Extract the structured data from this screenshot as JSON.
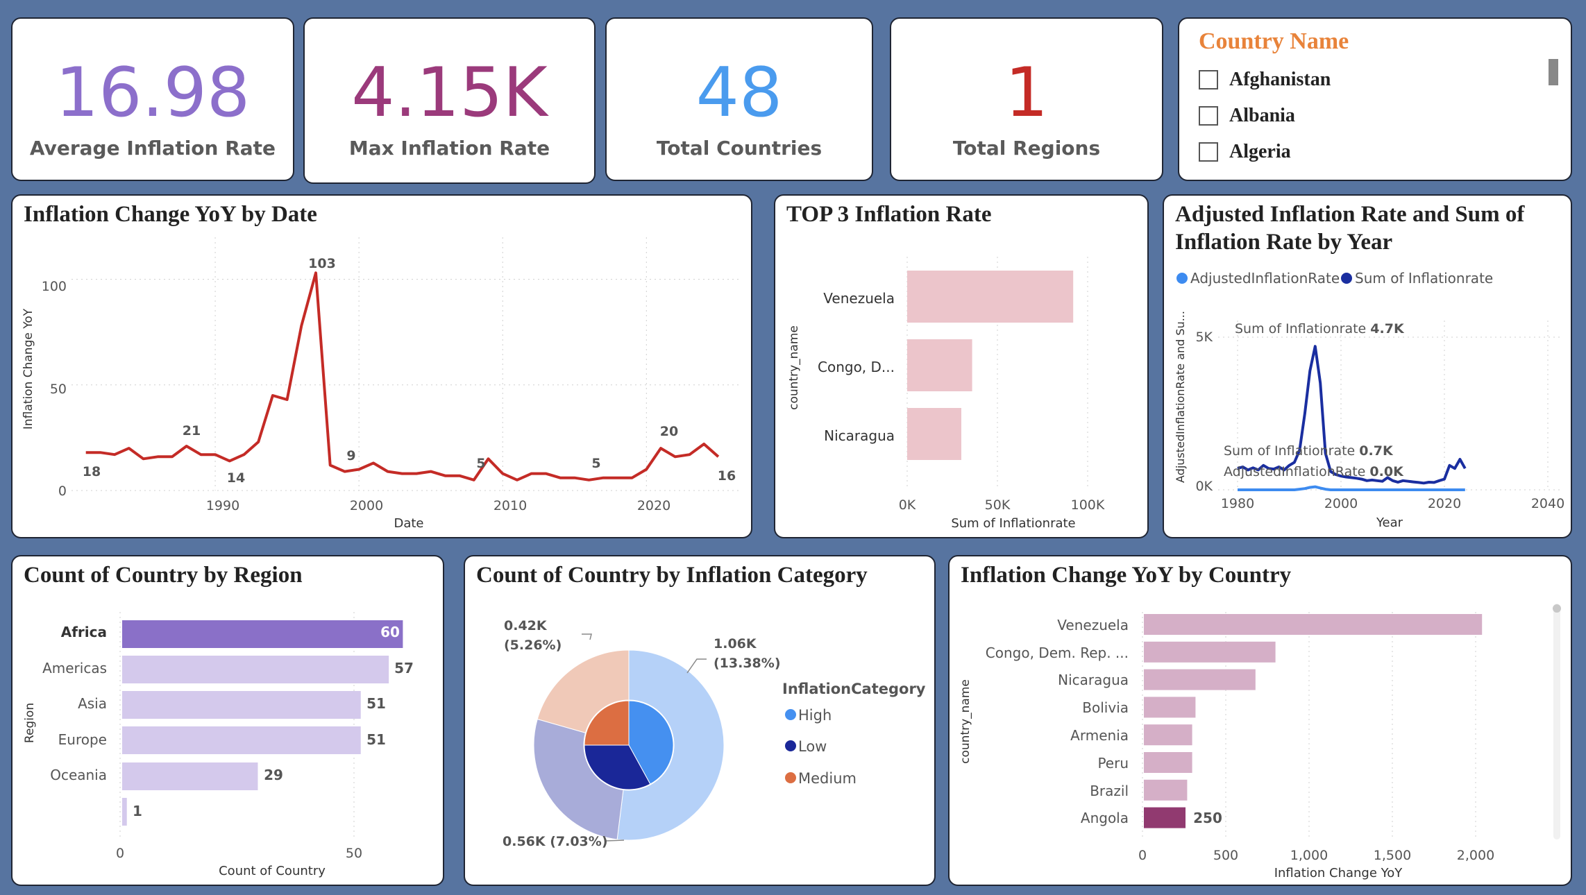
{
  "kpis": [
    {
      "value": "16.98",
      "label": "Average Inflation Rate",
      "color": "#8c6fcb"
    },
    {
      "value": "4.15K",
      "label": "Max Inflation Rate",
      "color": "#9b3a7b"
    },
    {
      "value": "48",
      "label": "Total Countries",
      "color": "#4a9bee"
    },
    {
      "value": "1",
      "label": "Total Regions",
      "color": "#c42b26"
    }
  ],
  "slicer": {
    "title": "Country Name",
    "items": [
      "Afghanistan",
      "Albania",
      "Algeria"
    ]
  },
  "charts": {
    "yoy_date": {
      "title": "Inflation Change YoY by Date",
      "xlabel": "Date",
      "ylabel": "Inflation Change YoY",
      "xticks": [
        "1990",
        "2000",
        "2010",
        "2020"
      ],
      "yticks": [
        "0",
        "50",
        "100"
      ],
      "labels": [
        "18",
        "21",
        "14",
        "103",
        "9",
        "5",
        "5",
        "20",
        "16"
      ]
    },
    "top3": {
      "title": "TOP 3 Inflation Rate",
      "xlabel": "Sum of Inflationrate",
      "ylabel": "country_name",
      "xticks": [
        "0K",
        "50K",
        "100K"
      ],
      "categories": [
        "Venezuela",
        "Congo, D...",
        "Nicaragua"
      ]
    },
    "adjusted": {
      "title_line1": "Adjusted Inflation Rate and Sum of",
      "title_line2": "Inflation Rate by Year",
      "xlabel": "Year",
      "ylabel": "AdjustedInflationRate and Su...",
      "xticks": [
        "1980",
        "2000",
        "2020",
        "2040"
      ],
      "yticks": [
        "0K",
        "5K"
      ],
      "legend": [
        "AdjustedInflationRate",
        "Sum of Inflationrate"
      ],
      "ann1_label": "Sum of Inflationrate",
      "ann1_value": "4.7K",
      "ann2_label": "Sum of Inflationrate",
      "ann2_value": "0.7K",
      "ann3_label": "AdjustedInflationRate",
      "ann3_value": "0.0K"
    },
    "region": {
      "title": "Count of Country by Region",
      "xlabel": "Count of Country",
      "ylabel": "Region",
      "xticks": [
        "0",
        "50"
      ],
      "categories": [
        "Africa",
        "Americas",
        "Asia",
        "Europe",
        "Oceania",
        ""
      ],
      "value_labels": [
        "60",
        "57",
        "51",
        "51",
        "29",
        "1"
      ]
    },
    "category": {
      "title": "Count of Country by Inflation Category",
      "legend_title": "InflationCategory",
      "legend": [
        "High",
        "Low",
        "Medium"
      ],
      "lbl_a": "1.06K",
      "lbl_a2": "(13.38%)",
      "lbl_b": "0.42K",
      "lbl_b2": "(5.26%)",
      "lbl_c": "0.56K (7.03%)"
    },
    "yoy_country": {
      "title": "Inflation Change YoY by Country",
      "xlabel": "Inflation Change YoY",
      "ylabel": "country_name",
      "xticks": [
        "0",
        "500",
        "1,000",
        "1,500",
        "2,000"
      ],
      "categories": [
        "Venezuela",
        "Congo, Dem. Rep. ...",
        "Nicaragua",
        "Bolivia",
        "Armenia",
        "Peru",
        "Brazil",
        "Angola"
      ],
      "value_label": "250"
    }
  },
  "chart_data": [
    {
      "type": "line",
      "title": "Inflation Change YoY by Date",
      "xlabel": "Date",
      "ylabel": "Inflation Change YoY",
      "ylim": [
        0,
        110
      ],
      "x": [
        1981,
        1982,
        1983,
        1984,
        1985,
        1986,
        1987,
        1988,
        1989,
        1990,
        1991,
        1992,
        1993,
        1994,
        1995,
        1996,
        1997,
        1998,
        1999,
        2000,
        2001,
        2002,
        2003,
        2004,
        2005,
        2006,
        2007,
        2008,
        2009,
        2010,
        2011,
        2012,
        2013,
        2014,
        2015,
        2016,
        2017,
        2018,
        2019,
        2020,
        2021,
        2022,
        2023,
        2024,
        2025
      ],
      "values": [
        18,
        18,
        17,
        20,
        15,
        16,
        16,
        21,
        17,
        17,
        14,
        17,
        23,
        45,
        43,
        78,
        103,
        12,
        9,
        10,
        13,
        9,
        8,
        8,
        9,
        7,
        7,
        5,
        15,
        8,
        5,
        8,
        8,
        6,
        6,
        5,
        6,
        6,
        6,
        10,
        20,
        16,
        17,
        22,
        16
      ],
      "color": "#c42b26"
    },
    {
      "type": "bar",
      "title": "TOP 3 Inflation Rate",
      "categories": [
        "Venezuela",
        "Congo, D...",
        "Nicaragua"
      ],
      "values": [
        92000,
        36000,
        30000
      ],
      "xlabel": "Sum of Inflationrate",
      "ylabel": "country_name",
      "xlim": [
        0,
        110000
      ],
      "color": "#ecc5cb"
    },
    {
      "type": "line",
      "title": "Adjusted Inflation Rate and Sum of Inflation Rate by Year",
      "xlabel": "Year",
      "ylabel": "AdjustedInflationRate and Su...",
      "xlim": [
        1978,
        2040
      ],
      "ylim": [
        0,
        5000
      ],
      "x": [
        1980,
        1981,
        1982,
        1983,
        1984,
        1985,
        1986,
        1987,
        1988,
        1989,
        1990,
        1991,
        1992,
        1993,
        1994,
        1995,
        1996,
        1997,
        1998,
        1999,
        2000,
        2001,
        2002,
        2003,
        2004,
        2005,
        2006,
        2007,
        2008,
        2009,
        2010,
        2011,
        2012,
        2013,
        2014,
        2015,
        2016,
        2017,
        2018,
        2019,
        2020,
        2021,
        2022,
        2023,
        2024
      ],
      "series": [
        {
          "name": "Sum of Inflationrate",
          "color": "#1a2ea0",
          "values": [
            700,
            750,
            650,
            720,
            650,
            800,
            700,
            680,
            750,
            650,
            800,
            900,
            1300,
            2500,
            3900,
            4700,
            3500,
            1200,
            600,
            500,
            450,
            420,
            400,
            380,
            350,
            300,
            320,
            300,
            280,
            400,
            300,
            250,
            300,
            280,
            260,
            240,
            220,
            250,
            240,
            300,
            350,
            800,
            700,
            1000,
            700
          ]
        },
        {
          "name": "AdjustedInflationRate",
          "color": "#3d8bf0",
          "values": [
            0,
            0,
            0,
            0,
            0,
            0,
            0,
            0,
            0,
            0,
            0,
            0,
            20,
            40,
            80,
            100,
            60,
            20,
            0,
            0,
            0,
            0,
            0,
            0,
            0,
            0,
            0,
            0,
            0,
            0,
            0,
            0,
            0,
            0,
            0,
            0,
            0,
            0,
            0,
            0,
            0,
            0,
            0,
            0,
            0
          ]
        }
      ]
    },
    {
      "type": "bar",
      "title": "Count of Country by Region",
      "categories": [
        "Africa",
        "Americas",
        "Asia",
        "Europe",
        "Oceania",
        ""
      ],
      "values": [
        60,
        57,
        51,
        51,
        29,
        1
      ],
      "xlabel": "Count of Country",
      "ylabel": "Region",
      "xlim": [
        0,
        65
      ],
      "colors": [
        "#8a70c8",
        "#d4c9ec"
      ]
    },
    {
      "type": "pie",
      "title": "Count of Country by Inflation Category",
      "legend": [
        "High",
        "Low",
        "Medium"
      ],
      "outer": [
        {
          "label": "1.06K (13.38%)",
          "value": 1060,
          "color": "#b5d1f8"
        },
        {
          "label": "0.56K (7.03%)",
          "value": 560,
          "color": "#a8acd9"
        },
        {
          "label": "0.42K (5.26%)",
          "value": 420,
          "color": "#f0c9b8"
        }
      ],
      "inner": [
        {
          "name": "High",
          "value": 42,
          "color": "#4590f0"
        },
        {
          "name": "Low",
          "value": 33,
          "color": "#1a2798"
        },
        {
          "name": "Medium",
          "value": 25,
          "color": "#dc6e42"
        }
      ]
    },
    {
      "type": "bar",
      "title": "Inflation Change YoY by Country",
      "categories": [
        "Venezuela",
        "Congo, Dem. Rep. ...",
        "Nicaragua",
        "Bolivia",
        "Armenia",
        "Peru",
        "Brazil",
        "Angola"
      ],
      "values": [
        2030,
        790,
        670,
        310,
        290,
        290,
        260,
        250
      ],
      "xlabel": "Inflation Change YoY",
      "ylabel": "country_name",
      "xlim": [
        0,
        2200
      ],
      "colors": [
        "#d5afc7",
        "#913a70"
      ]
    }
  ]
}
